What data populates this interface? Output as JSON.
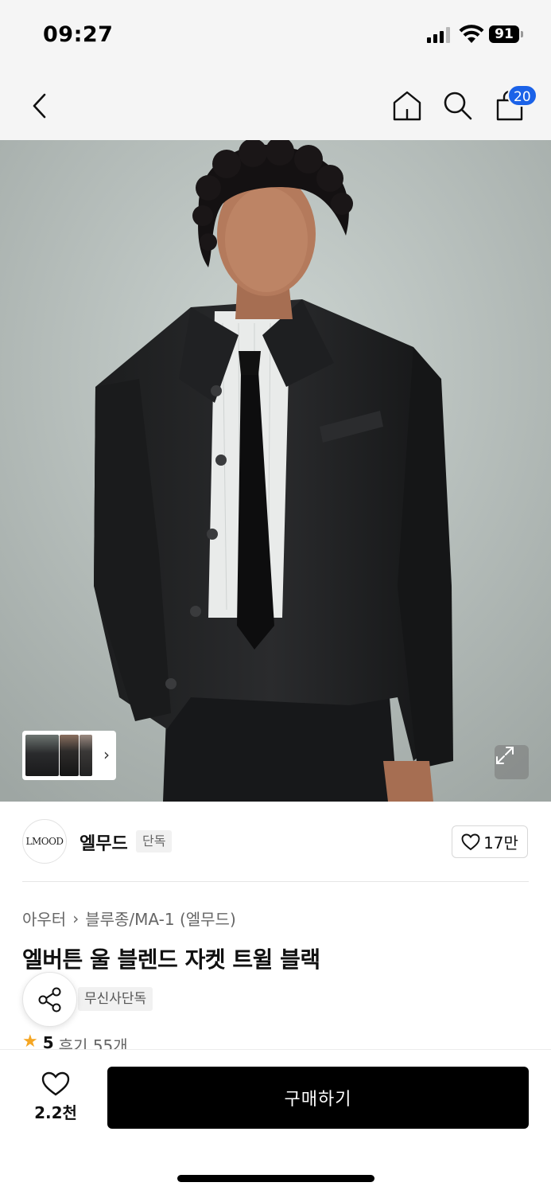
{
  "status_bar": {
    "time": "09:27",
    "battery": "91"
  },
  "nav": {
    "cart_count": "20"
  },
  "hero": {
    "image_alt": "Model wearing black wool jacket with white shirt and black tie"
  },
  "brand": {
    "logo_text": "LMOOD",
    "name": "엘무드",
    "tag": "단독",
    "followers": "17만"
  },
  "product": {
    "breadcrumb": [
      "아우터",
      "블루종/MA-1 (엘무드)"
    ],
    "title": "엘버튼 울 블렌드 자켓 트윌 블랙",
    "exclusive_badge": "무신사단독",
    "rating": "5",
    "reviews": "후기 55개"
  },
  "bottom_bar": {
    "like_count": "2.2천",
    "buy_label": "구매하기"
  }
}
